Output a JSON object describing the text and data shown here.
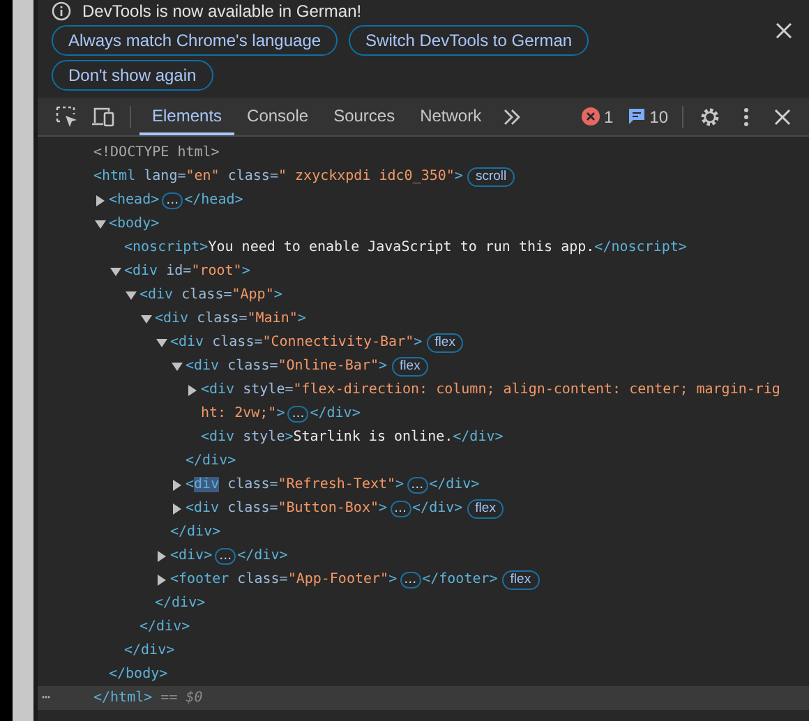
{
  "infobar": {
    "message": "DevTools is now available in German!",
    "buttons": [
      "Always match Chrome's language",
      "Switch DevTools to German",
      "Don't show again"
    ]
  },
  "toolbar": {
    "tabs": [
      {
        "label": "Elements",
        "selected": true
      },
      {
        "label": "Console",
        "selected": false
      },
      {
        "label": "Sources",
        "selected": false
      },
      {
        "label": "Network",
        "selected": false
      }
    ],
    "error_count": "1",
    "message_count": "10"
  },
  "tree": [
    {
      "line": [
        {
          "kind": "doctype",
          "text": "<!DOCTYPE html>"
        }
      ]
    },
    {
      "line": [
        {
          "kind": "tag",
          "text": "<html"
        },
        {
          "kind": "attr",
          "text": " lang="
        },
        {
          "kind": "value",
          "text": "\"en\""
        },
        {
          "kind": "attr",
          "text": " class="
        },
        {
          "kind": "value",
          "text": "\" zxyckxpdi idc0_350\""
        },
        {
          "kind": "tag",
          "text": ">"
        },
        {
          "kind": "badge",
          "text": "scroll"
        }
      ],
      "closing": [
        {
          "kind": "tag",
          "text": "</html>"
        },
        {
          "kind": "hint",
          "text": " == $0"
        }
      ],
      "closing_prefix": "⋯",
      "closing_selected": true,
      "children": [
        {
          "expanded": false,
          "line": [
            {
              "kind": "tag",
              "text": "<head>"
            },
            {
              "kind": "ellipsis",
              "text": "…"
            },
            {
              "kind": "tag",
              "text": "</head>"
            }
          ]
        },
        {
          "expanded": true,
          "line": [
            {
              "kind": "tag",
              "text": "<body>"
            }
          ],
          "closing": [
            {
              "kind": "tag",
              "text": "</body>"
            }
          ],
          "children": [
            {
              "line": [
                {
                  "kind": "tag",
                  "text": "<noscript>"
                },
                {
                  "kind": "text",
                  "text": "You need to enable JavaScript to run this app."
                },
                {
                  "kind": "tag",
                  "text": "</noscript>"
                }
              ]
            },
            {
              "expanded": true,
              "line": [
                {
                  "kind": "tag",
                  "text": "<div"
                },
                {
                  "kind": "attr",
                  "text": " id="
                },
                {
                  "kind": "value",
                  "text": "\"root\""
                },
                {
                  "kind": "tag",
                  "text": ">"
                }
              ],
              "closing": [
                {
                  "kind": "tag",
                  "text": "</div>"
                }
              ],
              "children": [
                {
                  "expanded": true,
                  "line": [
                    {
                      "kind": "tag",
                      "text": "<div"
                    },
                    {
                      "kind": "attr",
                      "text": " class="
                    },
                    {
                      "kind": "value",
                      "text": "\"App\""
                    },
                    {
                      "kind": "tag",
                      "text": ">"
                    }
                  ],
                  "closing": [
                    {
                      "kind": "tag",
                      "text": "</div>"
                    }
                  ],
                  "children": [
                    {
                      "expanded": true,
                      "line": [
                        {
                          "kind": "tag",
                          "text": "<div"
                        },
                        {
                          "kind": "attr",
                          "text": " class="
                        },
                        {
                          "kind": "value",
                          "text": "\"Main\""
                        },
                        {
                          "kind": "tag",
                          "text": ">"
                        }
                      ],
                      "closing": [
                        {
                          "kind": "tag",
                          "text": "</div>"
                        }
                      ],
                      "children": [
                        {
                          "expanded": true,
                          "line": [
                            {
                              "kind": "tag",
                              "text": "<div"
                            },
                            {
                              "kind": "attr",
                              "text": " class="
                            },
                            {
                              "kind": "value",
                              "text": "\"Connectivity-Bar\""
                            },
                            {
                              "kind": "tag",
                              "text": ">"
                            },
                            {
                              "kind": "badge",
                              "text": "flex"
                            }
                          ],
                          "closing": [
                            {
                              "kind": "tag",
                              "text": "</div>"
                            }
                          ],
                          "children": [
                            {
                              "expanded": true,
                              "line": [
                                {
                                  "kind": "tag",
                                  "text": "<div"
                                },
                                {
                                  "kind": "attr",
                                  "text": " class="
                                },
                                {
                                  "kind": "value",
                                  "text": "\"Online-Bar\""
                                },
                                {
                                  "kind": "tag",
                                  "text": ">"
                                },
                                {
                                  "kind": "badge",
                                  "text": "flex"
                                }
                              ],
                              "closing": [
                                {
                                  "kind": "tag",
                                  "text": "</div>"
                                }
                              ],
                              "children": [
                                {
                                  "expanded": false,
                                  "line": [
                                    {
                                      "kind": "tag",
                                      "text": "<div"
                                    },
                                    {
                                      "kind": "attr",
                                      "text": " style="
                                    },
                                    {
                                      "kind": "value",
                                      "text": "\"flex-direction: column; align-content: center; margin-rig"
                                    }
                                  ],
                                  "wrap": [
                                    {
                                      "kind": "value",
                                      "text": "ht: 2vw;\""
                                    },
                                    {
                                      "kind": "tag",
                                      "text": ">"
                                    },
                                    {
                                      "kind": "ellipsis",
                                      "text": "…"
                                    },
                                    {
                                      "kind": "tag",
                                      "text": "</div>"
                                    }
                                  ]
                                },
                                {
                                  "line": [
                                    {
                                      "kind": "tag",
                                      "text": "<div"
                                    },
                                    {
                                      "kind": "attr",
                                      "text": " style"
                                    },
                                    {
                                      "kind": "tag",
                                      "text": ">"
                                    },
                                    {
                                      "kind": "text",
                                      "text": "Starlink is online."
                                    },
                                    {
                                      "kind": "tag",
                                      "text": "</div>"
                                    }
                                  ]
                                }
                              ]
                            },
                            {
                              "expanded": false,
                              "line": [
                                {
                                  "kind": "tag",
                                  "text": "<"
                                },
                                {
                                  "kind": "tag",
                                  "text": "div",
                                  "highlighted": true
                                },
                                {
                                  "kind": "attr",
                                  "text": " class="
                                },
                                {
                                  "kind": "value",
                                  "text": "\"Refresh-Text\""
                                },
                                {
                                  "kind": "tag",
                                  "text": ">"
                                },
                                {
                                  "kind": "ellipsis",
                                  "text": "…"
                                },
                                {
                                  "kind": "tag",
                                  "text": "</div>"
                                }
                              ]
                            },
                            {
                              "expanded": false,
                              "line": [
                                {
                                  "kind": "tag",
                                  "text": "<div"
                                },
                                {
                                  "kind": "attr",
                                  "text": " class="
                                },
                                {
                                  "kind": "value",
                                  "text": "\"Button-Box\""
                                },
                                {
                                  "kind": "tag",
                                  "text": ">"
                                },
                                {
                                  "kind": "ellipsis",
                                  "text": "…"
                                },
                                {
                                  "kind": "tag",
                                  "text": "</div>"
                                },
                                {
                                  "kind": "badge",
                                  "text": "flex"
                                }
                              ]
                            }
                          ]
                        },
                        {
                          "expanded": false,
                          "line": [
                            {
                              "kind": "tag",
                              "text": "<div>"
                            },
                            {
                              "kind": "ellipsis",
                              "text": "…"
                            },
                            {
                              "kind": "tag",
                              "text": "</div>"
                            }
                          ]
                        },
                        {
                          "expanded": false,
                          "line": [
                            {
                              "kind": "tag",
                              "text": "<footer"
                            },
                            {
                              "kind": "attr",
                              "text": " class="
                            },
                            {
                              "kind": "value",
                              "text": "\"App-Footer\""
                            },
                            {
                              "kind": "tag",
                              "text": ">"
                            },
                            {
                              "kind": "ellipsis",
                              "text": "…"
                            },
                            {
                              "kind": "tag",
                              "text": "</footer>"
                            },
                            {
                              "kind": "badge",
                              "text": "flex"
                            }
                          ]
                        }
                      ]
                    }
                  ]
                }
              ]
            }
          ]
        }
      ]
    }
  ]
}
